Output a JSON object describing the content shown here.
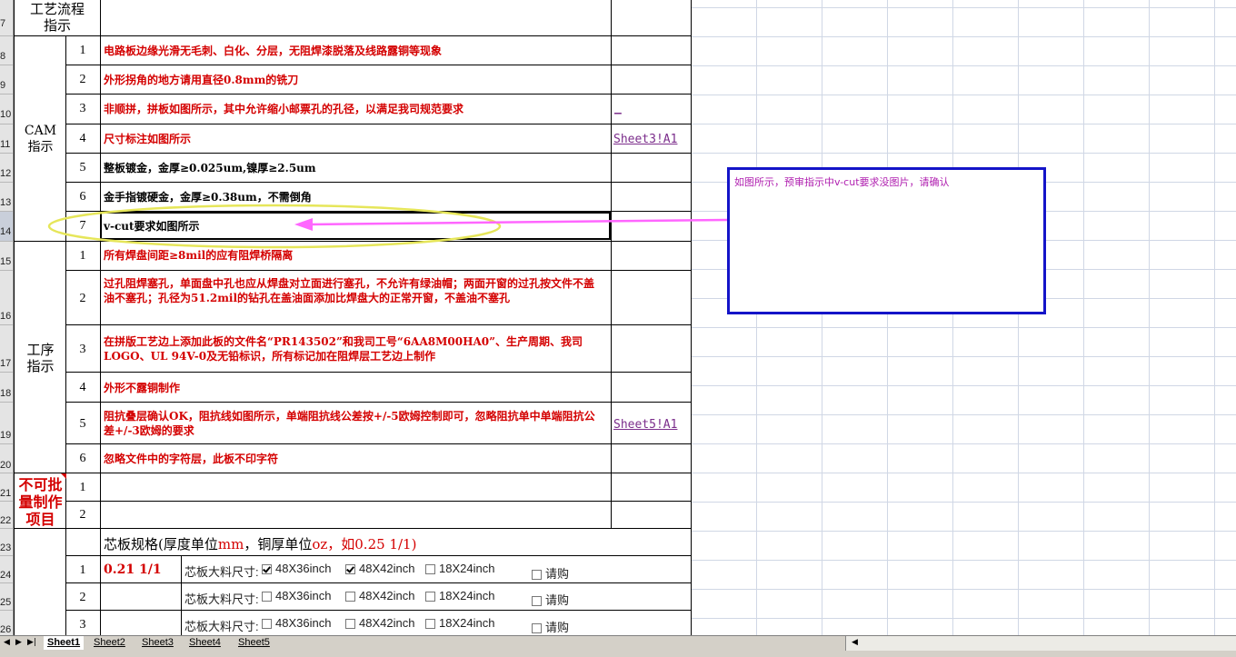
{
  "row_numbers": [
    "7",
    "8",
    "9",
    "10",
    "11",
    "12",
    "13",
    "14",
    "15",
    "16",
    "17",
    "18",
    "19",
    "20",
    "21",
    "22",
    "23",
    "24",
    "25",
    "26"
  ],
  "header": {
    "title_line1": "工艺流程",
    "title_line2": "指示"
  },
  "cam": {
    "label_line1": "CAM",
    "label_line2": "指示",
    "items": [
      {
        "n": "1",
        "text": "电路板边缘光滑无毛刺、白化、分层，无阻焊漆脱落及线路露铜等现象"
      },
      {
        "n": "2",
        "text": "外形拐角的地方请用直径0.8mm的铣刀"
      },
      {
        "n": "3",
        "text": "非顺拼，拼板如图所示，其中允许缩小邮票孔的孔径，以满足我司规范要求"
      },
      {
        "n": "4",
        "text": "尺寸标注如图所示",
        "link": "Sheet3!A1"
      },
      {
        "n": "5",
        "text": "整板镀金，金厚≥0.025um,镍厚≥2.5um"
      },
      {
        "n": "6",
        "text": "金手指镀硬金，金厚≥0.38um，不需倒角"
      },
      {
        "n": "7",
        "text": "v-cut要求如图所示"
      }
    ]
  },
  "process": {
    "label_line1": "工序",
    "label_line2": "指示",
    "items": [
      {
        "n": "1",
        "text": "所有焊盘间距≥8mil的应有阻焊桥隔离"
      },
      {
        "n": "2",
        "text": "过孔阻焊塞孔，单面盘中孔也应从焊盘对立面进行塞孔，不允许有绿油帽；两面开窗的过孔按文件不盖油不塞孔；孔径为51.2mil的钻孔在盖油面添加比焊盘大的正常开窗，不盖油不塞孔"
      },
      {
        "n": "3",
        "text": "在拼版工艺边上添加此板的文件名“PR143502”和我司工号“6AA8M00HA0”、生产周期、我司LOGO、UL 94V-0及无铅标识，所有标记加在阻焊层工艺边上制作"
      },
      {
        "n": "4",
        "text": "外形不露铜制作"
      },
      {
        "n": "5",
        "text": "阻抗叠层确认OK，阻抗线如图所示，单端阻抗线公差按+/-5欧姆控制即可，忽略阻抗单中单端阻抗公差+/-3欧姆的要求",
        "link": "Sheet5!A1"
      },
      {
        "n": "6",
        "text": "忽略文件中的字符层，此板不印字符"
      }
    ]
  },
  "no_batch": {
    "label_line1": "不可批",
    "label_line2": "量制作",
    "label_line3": "项目",
    "items": [
      "1",
      "2"
    ]
  },
  "core": {
    "title_prefix": "芯板规格(厚度单位",
    "title_mm": "mm",
    "title_mid": "，铜厚单位",
    "title_oz": "oz",
    "title_ex": "，如0.25 1/1)",
    "size_label": "芯板大料尺寸:",
    "opt1": "48X36inch",
    "opt2": "48X42inch",
    "opt3": "18X24inch",
    "opt4": "请购",
    "rows": [
      {
        "n": "1",
        "spec": "0.21 1/1",
        "checks": [
          true,
          true,
          false,
          false
        ]
      },
      {
        "n": "2",
        "spec": "",
        "checks": [
          false,
          false,
          false,
          false
        ]
      },
      {
        "n": "3",
        "spec": "",
        "checks": [
          false,
          false,
          false,
          false
        ]
      }
    ]
  },
  "comment": {
    "text": "如图所示，预审指示中v-cut要求没图片，请确认"
  },
  "misc_link": "_",
  "tabs": [
    "Sheet1",
    "Sheet2",
    "Sheet3",
    "Sheet4",
    "Sheet5"
  ],
  "colors": {
    "accent_red": "#d40000",
    "comment_border": "#1414c8",
    "annotation_pink": "#ff66ff",
    "highlight_ellipse": "#e6e65a"
  }
}
